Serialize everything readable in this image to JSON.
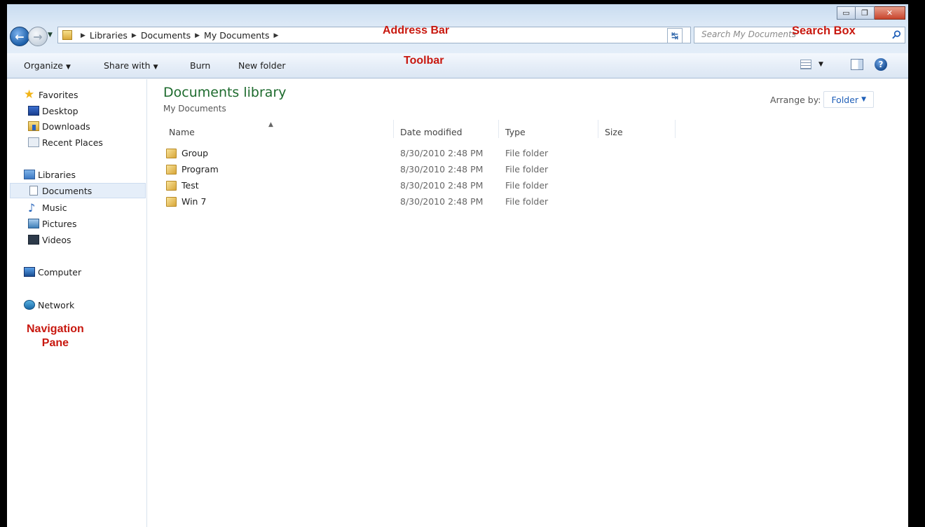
{
  "window": {
    "buttons": {
      "minimize": "▭",
      "maximize": "❐",
      "close": "✕"
    }
  },
  "address_bar": {
    "crumbs": [
      "Libraries",
      "Documents",
      "My Documents"
    ]
  },
  "search": {
    "placeholder": "Search My Documents"
  },
  "annotations": {
    "address_bar": "Address Bar",
    "search_box": "Search Box",
    "toolbar": "Toolbar",
    "navigation_pane_line1": "Navigation",
    "navigation_pane_line2": "Pane"
  },
  "toolbar": {
    "organize": "Organize",
    "share_with": "Share with",
    "burn": "Burn",
    "new_folder": "New folder"
  },
  "navigation": {
    "favorites": "Favorites",
    "desktop": "Desktop",
    "downloads": "Downloads",
    "recent_places": "Recent Places",
    "libraries": "Libraries",
    "documents": "Documents",
    "music": "Music",
    "pictures": "Pictures",
    "videos": "Videos",
    "computer": "Computer",
    "network": "Network"
  },
  "content": {
    "title": "Documents library",
    "subtitle": "My Documents",
    "arrange_label": "Arrange by:",
    "arrange_value": "Folder",
    "columns": {
      "name": "Name",
      "date": "Date modified",
      "type": "Type",
      "size": "Size"
    },
    "files": [
      {
        "name": "Group",
        "date": "8/30/2010 2:48 PM",
        "type": "File folder",
        "size": ""
      },
      {
        "name": "Program",
        "date": "8/30/2010 2:48 PM",
        "type": "File folder",
        "size": ""
      },
      {
        "name": "Test",
        "date": "8/30/2010 2:48 PM",
        "type": "File folder",
        "size": ""
      },
      {
        "name": "Win 7",
        "date": "8/30/2010 2:48 PM",
        "type": "File folder",
        "size": ""
      }
    ]
  },
  "colors": {
    "annotation": "#c8180f",
    "library_title": "#1e6b2e",
    "link_blue": "#1f5fb8"
  }
}
